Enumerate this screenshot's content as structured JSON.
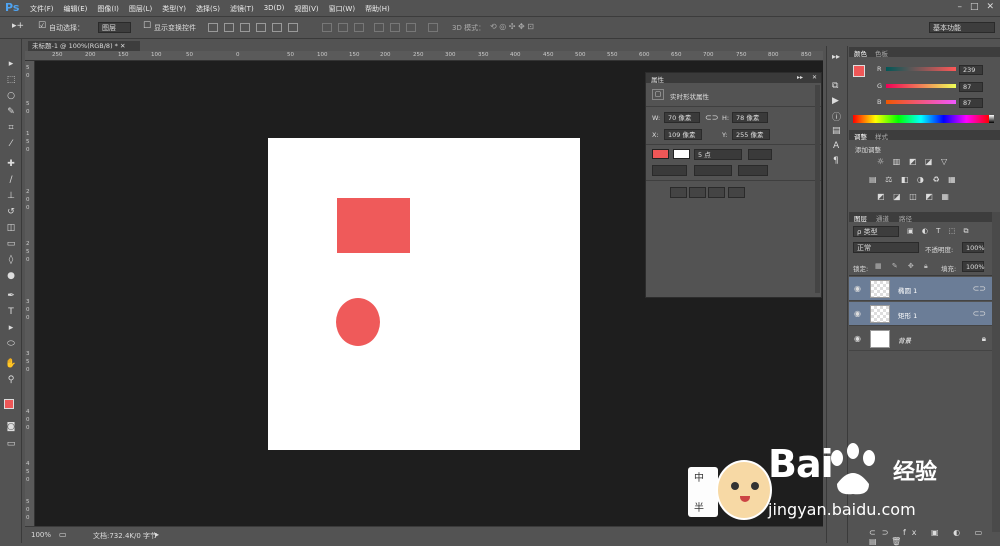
{
  "menubar": {
    "logo": "Ps",
    "items": [
      "文件(F)",
      "编辑(E)",
      "图像(I)",
      "图层(L)",
      "类型(Y)",
      "选择(S)",
      "滤镜(T)",
      "3D(D)",
      "视图(V)",
      "窗口(W)",
      "帮助(H)"
    ]
  },
  "options": {
    "auto_select_label": "自动选择：",
    "auto_select_value": "图层",
    "show_transform_label": "显示变换控件",
    "mode_3d_label": "3D 模式：",
    "workspace": "基本功能"
  },
  "document": {
    "tab_title": "未标题-1 @ 100%(RGB/8) *",
    "zoom": "100%",
    "doc_info": "文档:732.4K/0 字节"
  },
  "ruler": {
    "top": [
      "250",
      "200",
      "150",
      "100",
      "50",
      "0",
      "50",
      "100",
      "150",
      "200",
      "250",
      "300",
      "350",
      "400",
      "450",
      "500",
      "550",
      "600",
      "650",
      "700",
      "750",
      "800",
      "850"
    ],
    "left": [
      "5",
      "0",
      "5",
      "0",
      "1",
      "5",
      "0",
      "2",
      "0",
      "0",
      "2",
      "5",
      "0",
      "3",
      "0",
      "0",
      "3",
      "5",
      "0",
      "4",
      "0",
      "0",
      "4",
      "5",
      "0",
      "5",
      "0",
      "0",
      "5",
      "5",
      "0"
    ]
  },
  "properties": {
    "panel_title": "属性",
    "section_title": "实时形状属性",
    "w_label": "W:",
    "w_value": "70 像素",
    "h_label": "H:",
    "h_value": "78 像素",
    "x_label": "X:",
    "x_value": "109 像素",
    "y_label": "Y:",
    "y_value": "255 像素",
    "stroke_size": "5 点"
  },
  "color_panel": {
    "tab_color": "颜色",
    "tab_swatches": "色板",
    "r_label": "R",
    "g_label": "G",
    "b_label": "B",
    "r": "239",
    "g": "87",
    "b": "87",
    "fg_color": "#ef5757"
  },
  "adjust_panel": {
    "tab_adjust": "调整",
    "tab_styles": "样式",
    "add_adjustment": "添加调整"
  },
  "layers_panel": {
    "tab_layers": "图层",
    "tab_channels": "通道",
    "tab_paths": "路径",
    "filter_kind": "ρ 类型",
    "blend_mode": "正常",
    "opacity_label": "不透明度:",
    "opacity": "100%",
    "lock_label": "锁定:",
    "fill_label": "填充:",
    "fill": "100%",
    "layers": [
      {
        "name": "椭圆 1",
        "selected": true
      },
      {
        "name": "矩形 1",
        "selected": true
      },
      {
        "name": "背景",
        "selected": false
      }
    ]
  },
  "watermark": {
    "brand": "Bai",
    "brand2": "du",
    "jingyan": "经验",
    "url": "jingyan.baidu.com",
    "char1": "中",
    "char2": "半"
  },
  "colors": {
    "shape_fill": "#ef5a5a",
    "layer_selected": "#6b7d97"
  }
}
